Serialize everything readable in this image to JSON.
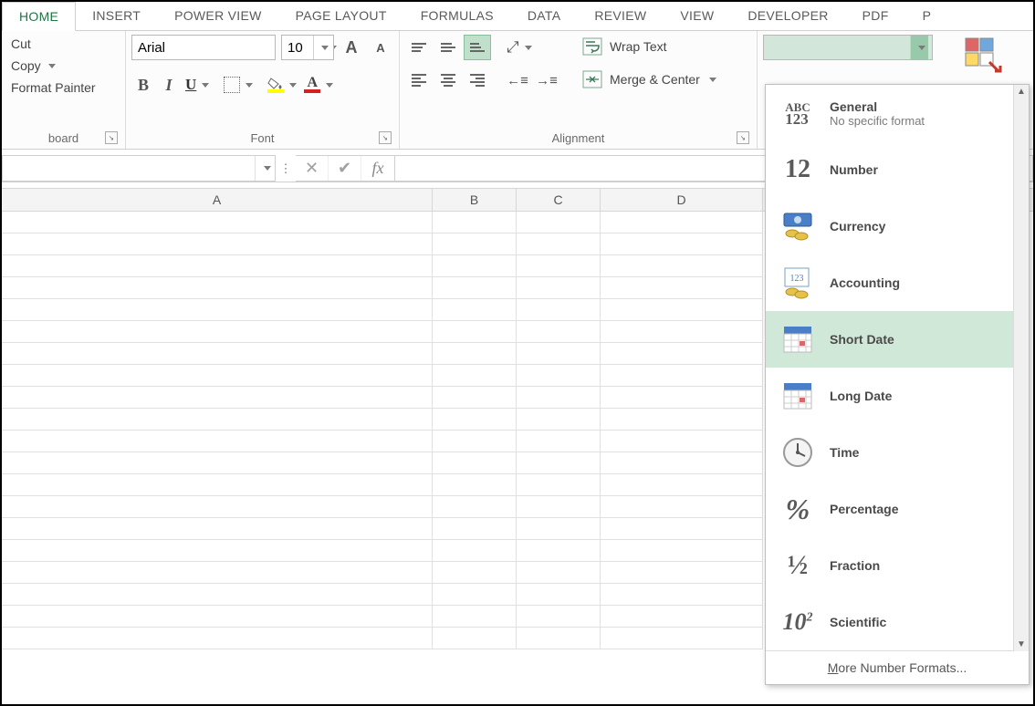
{
  "tabs": {
    "items": [
      {
        "label": "HOME",
        "active": true
      },
      {
        "label": "INSERT"
      },
      {
        "label": "POWER VIEW"
      },
      {
        "label": "PAGE LAYOUT"
      },
      {
        "label": "FORMULAS"
      },
      {
        "label": "DATA"
      },
      {
        "label": "REVIEW"
      },
      {
        "label": "VIEW"
      },
      {
        "label": "DEVELOPER"
      },
      {
        "label": "PDF"
      },
      {
        "label": "P"
      }
    ]
  },
  "clipboard": {
    "cut": "Cut",
    "copy": "Copy",
    "format_painter": "Format Painter",
    "group": "board"
  },
  "font": {
    "name": "Arial",
    "size": "10",
    "group": "Font"
  },
  "alignment": {
    "wrap": "Wrap Text",
    "merge": "Merge & Center",
    "group": "Alignment"
  },
  "number_format": {
    "value": "",
    "dropdown": [
      {
        "title": "General",
        "sub": "No specific format",
        "icon": "abc123"
      },
      {
        "title": "Number",
        "icon": "12"
      },
      {
        "title": "Currency",
        "icon": "currency"
      },
      {
        "title": "Accounting",
        "icon": "accounting"
      },
      {
        "title": "Short Date",
        "icon": "cal",
        "selected": true
      },
      {
        "title": "Long Date",
        "icon": "cal"
      },
      {
        "title": "Time",
        "icon": "clock"
      },
      {
        "title": "Percentage",
        "icon": "pct"
      },
      {
        "title": "Fraction",
        "icon": "frac"
      },
      {
        "title": "Scientific",
        "icon": "sci"
      }
    ],
    "footer_pre": "M",
    "footer_rest": "ore Number Formats..."
  },
  "formula_bar": {
    "name": "",
    "formula": ""
  },
  "columns": [
    "A",
    "B",
    "C",
    "D"
  ],
  "row_count": 20
}
